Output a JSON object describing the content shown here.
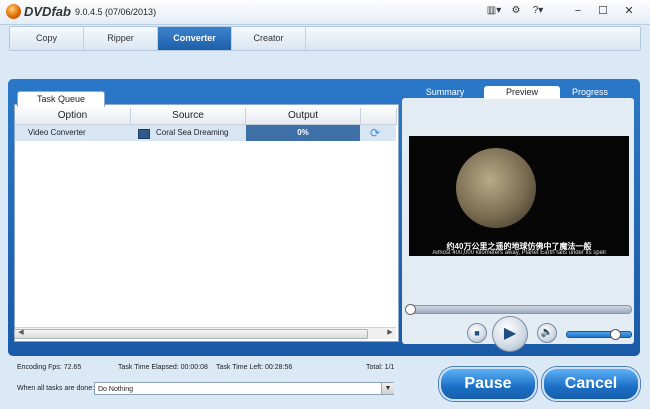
{
  "app": {
    "brand": "DVDfab",
    "version": "9.0.4.5 (07/06/2013)"
  },
  "titlebar_icons": {
    "settings": "⚙",
    "help": "?▾",
    "skin": "▥▾"
  },
  "tabs": [
    "Copy",
    "Ripper",
    "Converter",
    "Creator"
  ],
  "active_tab": "Converter",
  "task_queue": {
    "tab_label": "Task Queue",
    "columns": [
      "Option",
      "Source",
      "Output"
    ],
    "rows": [
      {
        "option": "Video Converter",
        "source": "Coral Sea Dreaming",
        "output": "0%"
      }
    ]
  },
  "right_tabs": [
    "Summary",
    "Preview",
    "Progress"
  ],
  "active_right_tab": "Preview",
  "preview": {
    "subtitle_cn": "约40万公里之遥的地球仿佛中了魔法一般",
    "subtitle_en": "Almost 400,000 kilometers away, Planet Earth falls under its spell"
  },
  "player": {
    "seek": 0.0,
    "volume": 0.78
  },
  "status": {
    "encoding_fps": "Encoding Fps: 72.65",
    "elapsed": "Task Time Elapsed: 00:00:08",
    "left": "Task Time Left: 00:28:56",
    "total": "Total: 1/1"
  },
  "when_done": {
    "label": "When all tasks are done:",
    "value": "Do Nothing"
  },
  "buttons": {
    "pause": "Pause",
    "cancel": "Cancel"
  }
}
